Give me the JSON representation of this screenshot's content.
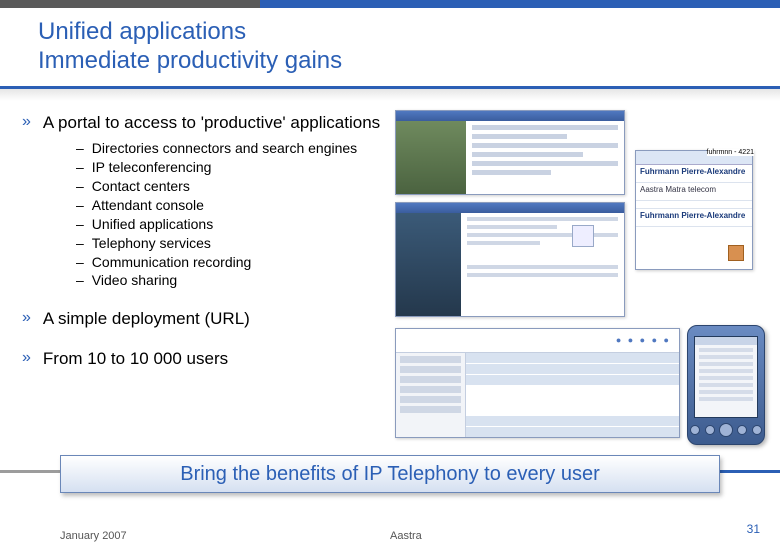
{
  "title_line1": "Unified applications",
  "title_line2": "Immediate productivity gains",
  "bullets": {
    "b1": "A portal to access to 'productive' applications",
    "b2": "A simple deployment (URL)",
    "b3": "From 10 to 10 000 users"
  },
  "sub": {
    "s1": "Directories connectors and search engines",
    "s2": "IP teleconferencing",
    "s3": "Contact centers",
    "s4": "Attendant console",
    "s5": "Unified applications",
    "s6": "Telephony services",
    "s7": "Communication recording",
    "s8": "Video sharing"
  },
  "tagline": "Bring the benefits of IP Telephony to every user",
  "footer": {
    "date": "January 2007",
    "brand": "Aastra",
    "page": "31"
  },
  "contact_card": {
    "label": "fuhrmnn - 4221",
    "name1": "Fuhrmann Pierre-Alexandre",
    "name2": "Aastra Matra telecom",
    "name3": "Fuhrmann Pierre-Alexandre"
  }
}
